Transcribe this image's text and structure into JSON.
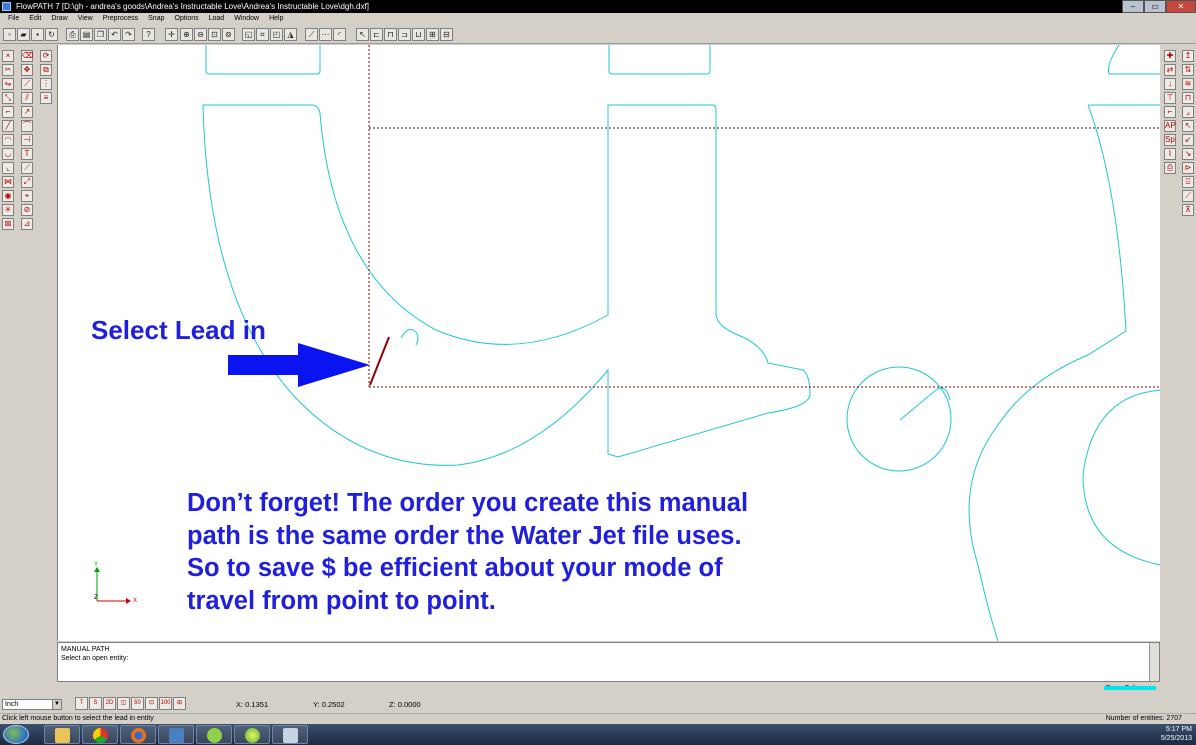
{
  "window": {
    "title": "FlowPATH 7 [D:\\gh - andrea's goods\\Andrea's Instructable Love\\Andrea's Instructable Love\\dgh.dxf]",
    "minimize": "–",
    "maximize": "▭",
    "close": "✕"
  },
  "menu": [
    "File",
    "Edit",
    "Draw",
    "View",
    "Preprocess",
    "Snap",
    "Options",
    "Load",
    "Window",
    "Help"
  ],
  "canvas": {
    "lead_label": "Select Lead in",
    "reminder_lines": [
      "Don’t forget! The order you create this manual",
      "path is the same order the Water Jet file uses.",
      "So to save $ be efficient about your mode of",
      "travel from point to point."
    ],
    "axis": {
      "x": "X",
      "y": "Y",
      "z": "Z"
    }
  },
  "command": {
    "title": "MANUAL PATH",
    "prompt": "Select an open entity:"
  },
  "status": {
    "draw_color_label": "Draw Color",
    "draw_color": "#00e5ee",
    "units": "Inch",
    "x": "X: 0.1351",
    "y": "Y: 0.2502",
    "z": "Z: 0.0000",
    "hint": "Click left mouse button to select the lead in entity",
    "entities": "Number of entities:  2707"
  },
  "tray": {
    "time": "5:17 PM",
    "date": "5/25/2013"
  },
  "colors": {
    "geometry": "#1ec8d0",
    "toolpath": "#8b0000",
    "annotation": "#1f1fdc"
  }
}
